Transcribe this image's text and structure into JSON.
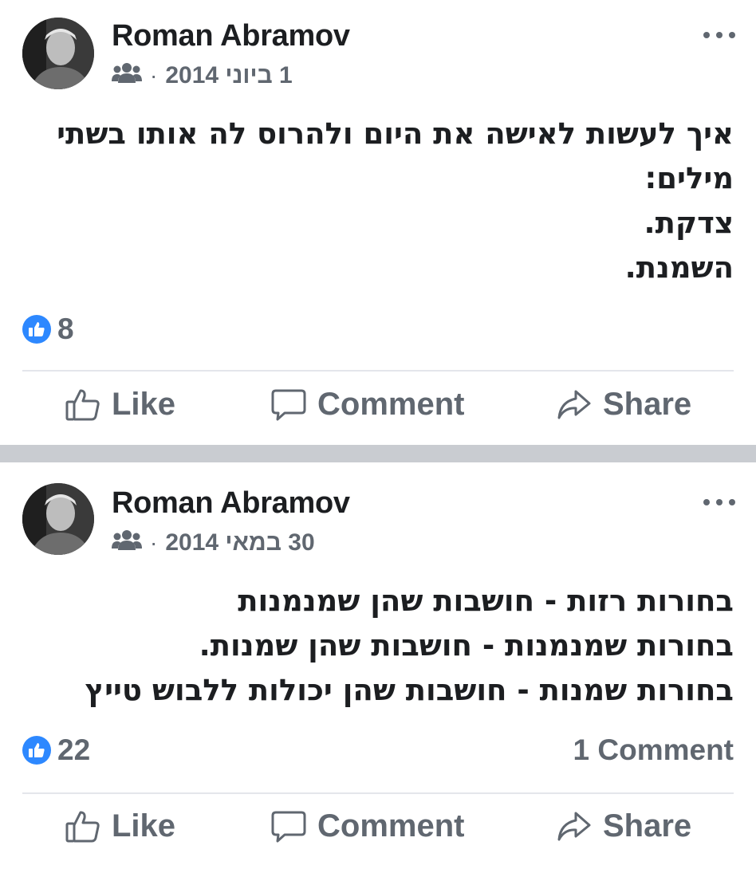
{
  "posts": [
    {
      "author": "Roman Abramov",
      "audience_icon": "friends-icon",
      "date": "1 ביוני 2014",
      "text_lines": [
        "איך לעשות לאישה את היום ולהרוס לה אותו בשתי",
        "מילים:",
        "צדקת.",
        "השמנת."
      ],
      "reaction_icon": "like-reaction-icon",
      "reaction_count": "8",
      "comment_count": "",
      "actions": {
        "like": "Like",
        "comment": "Comment",
        "share": "Share"
      }
    },
    {
      "author": "Roman Abramov",
      "audience_icon": "friends-icon",
      "date": "30 במאי 2014",
      "text_lines": [
        "בחורות רזות - חושבות שהן שמנמנות",
        "בחורות שמנמנות - חושבות שהן שמנות.",
        "בחורות שמנות - חושבות שהן יכולות ללבוש טייץ"
      ],
      "reaction_icon": "like-reaction-icon",
      "reaction_count": "22",
      "comment_count": "1 Comment",
      "actions": {
        "like": "Like",
        "comment": "Comment",
        "share": "Share"
      }
    }
  ],
  "colors": {
    "like_blue": "#2d88ff",
    "secondary_text": "#606770",
    "separator": "#c9ccd1"
  }
}
